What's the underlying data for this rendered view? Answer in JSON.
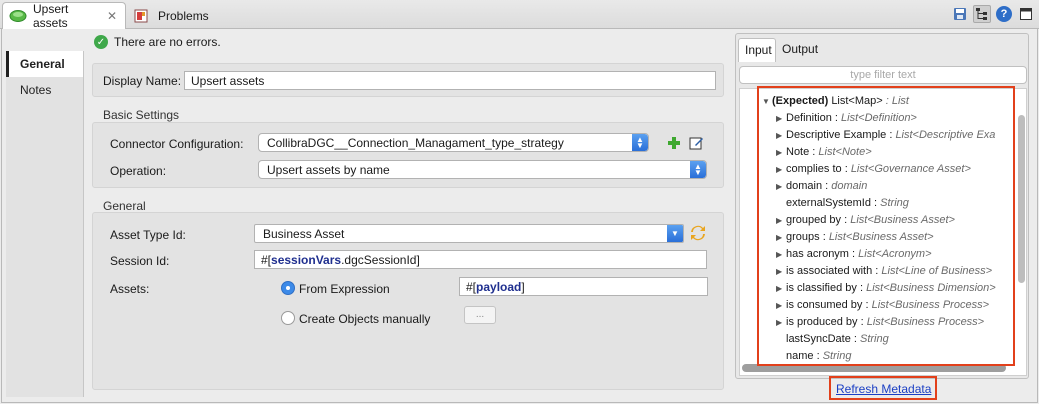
{
  "tabs": [
    {
      "label": "Upsert assets",
      "icon": "mule-component-icon",
      "active": true
    },
    {
      "label": "Problems",
      "icon": "problems-icon",
      "active": false
    }
  ],
  "toolbar": {
    "icons": [
      "save-icon",
      "tree-structure-icon",
      "help-icon",
      "maximize-icon"
    ],
    "help_glyph": "?"
  },
  "nav": {
    "items": [
      "General",
      "Notes"
    ],
    "active": "General"
  },
  "status": {
    "text": "There are no errors.",
    "icon": "check-circle-icon"
  },
  "display_name": {
    "label": "Display Name:",
    "value": "Upsert assets"
  },
  "basic_settings": {
    "title": "Basic Settings",
    "connector_label": "Connector Configuration:",
    "connector_value": "CollibraDGC__Connection_Managament_type_strategy",
    "operation_label": "Operation:",
    "operation_value": "Upsert assets by name"
  },
  "general": {
    "title": "General",
    "asset_type_label": "Asset Type Id:",
    "asset_type_value": "Business Asset",
    "session_label": "Session Id:",
    "session_prefix": "#[",
    "session_keyword": "sessionVars",
    "session_suffix": ".dgcSessionId]",
    "assets_label": "Assets:",
    "radio_expression": "From Expression",
    "radio_manual": "Create Objects manually",
    "expression_prefix": "#[",
    "expression_keyword": "payload",
    "expression_suffix": "]",
    "manual_button": "...",
    "selected_radio": "From Expression"
  },
  "metadata": {
    "tabs": [
      "Input",
      "Output"
    ],
    "active_tab": "Input",
    "filter_placeholder": "type filter text",
    "root": {
      "label": "(Expected)",
      "type_main": "List<Map>",
      "type_suffix": ": List"
    },
    "rows": [
      {
        "name": "Definition",
        "type": "List<Definition>",
        "expandable": true
      },
      {
        "name": "Descriptive Example",
        "type": "List<Descriptive Exa",
        "expandable": true
      },
      {
        "name": "Note",
        "type": "List<Note>",
        "expandable": true
      },
      {
        "name": "complies to",
        "type": "List<Governance Asset>",
        "expandable": true
      },
      {
        "name": "domain",
        "type": "domain",
        "expandable": true
      },
      {
        "name": "externalSystemId",
        "type": "String",
        "expandable": false
      },
      {
        "name": "grouped by",
        "type": "List<Business Asset>",
        "expandable": true
      },
      {
        "name": "groups",
        "type": "List<Business Asset>",
        "expandable": true
      },
      {
        "name": "has acronym",
        "type": "List<Acronym>",
        "expandable": true
      },
      {
        "name": "is associated with",
        "type": "List<Line of Business>",
        "expandable": true
      },
      {
        "name": "is classified by",
        "type": "List<Business Dimension>",
        "expandable": true
      },
      {
        "name": "is consumed by",
        "type": "List<Business Process>",
        "expandable": true
      },
      {
        "name": "is produced by",
        "type": "List<Business Process>",
        "expandable": true
      },
      {
        "name": "lastSyncDate",
        "type": "String",
        "expandable": false
      },
      {
        "name": "name",
        "type": "String",
        "expandable": false
      }
    ],
    "refresh_link": "Refresh Metadata"
  },
  "colors": {
    "highlight": "#e2401b",
    "accent": "#2a6fd8",
    "link": "#1b3fc4",
    "ok": "#3fa84a"
  }
}
